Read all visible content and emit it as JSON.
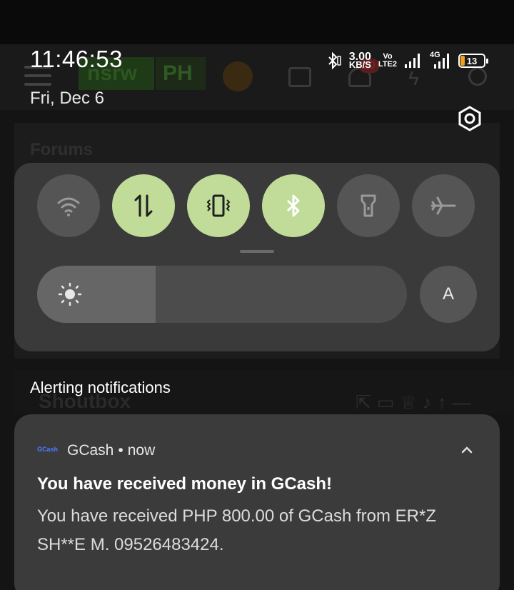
{
  "status_bar": {
    "time": "11:46:53",
    "date": "Fri, Dec 6",
    "net_speed_value": "3.00",
    "net_speed_unit": "KB/S",
    "volte": "Vo",
    "volte_sub": "LTE2",
    "network_type": "4G",
    "battery_level": "13"
  },
  "background_app": {
    "logo_left": "nsrw",
    "logo_right": "PH",
    "notification_count": "20",
    "section_forums": "Forums",
    "section_shoutbox": "Shoutbox"
  },
  "quick_settings": {
    "tiles": [
      {
        "name": "wifi",
        "active": false
      },
      {
        "name": "mobile-data",
        "active": true
      },
      {
        "name": "vibrate",
        "active": true
      },
      {
        "name": "bluetooth",
        "active": true
      },
      {
        "name": "flashlight",
        "active": false
      },
      {
        "name": "airplane-mode",
        "active": false
      }
    ],
    "brightness_fraction": 0.32,
    "auto_brightness_label": "A",
    "colors": {
      "active": "#c0dc98",
      "inactive": "#555555",
      "panel": "#3a3a3a"
    }
  },
  "notifications": {
    "section_heading": "Alerting notifications",
    "items": [
      {
        "app_icon_text": "GCash",
        "app_name": "GCash",
        "separator": "•",
        "time": "now",
        "title": "You have received money in GCash!",
        "body": "You have received PHP 800.00 of GCash from ER*Z SH**E M. 09526483424."
      }
    ]
  }
}
